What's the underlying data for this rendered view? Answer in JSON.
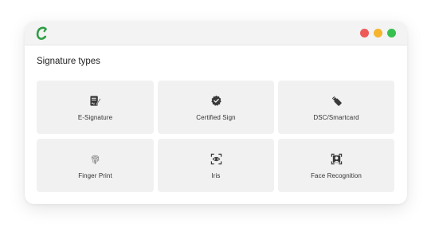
{
  "app": {
    "logo_letter": "C",
    "logo_color": "#2e9e44"
  },
  "window_controls": {
    "close_color": "#ee5a58",
    "minimize_color": "#f5b52d",
    "maximize_color": "#38c04f"
  },
  "section": {
    "title": "Signature types"
  },
  "signature_types": [
    {
      "label": "E-Signature",
      "icon": "e-signature-icon"
    },
    {
      "label": "Certified Sign",
      "icon": "certified-badge-icon"
    },
    {
      "label": "DSC/Smartcard",
      "icon": "usb-token-icon"
    },
    {
      "label": "Finger Print",
      "icon": "fingerprint-icon"
    },
    {
      "label": "Iris",
      "icon": "iris-scan-icon"
    },
    {
      "label": "Face Recognition",
      "icon": "face-scan-icon"
    }
  ]
}
